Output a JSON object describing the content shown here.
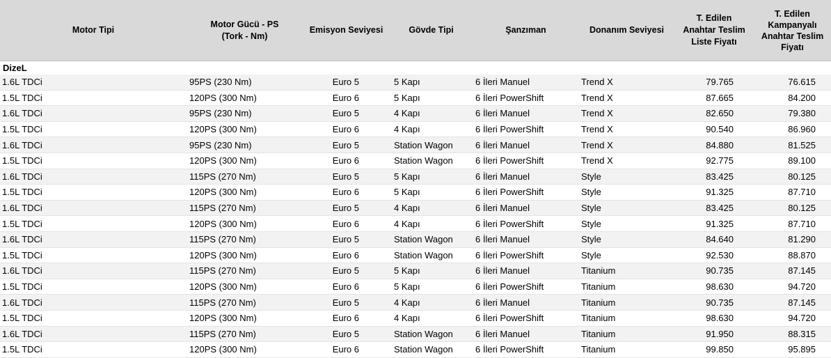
{
  "headers": {
    "motor_tipi": "Motor Tipi",
    "motor_gucu_1": "Motor Gücü - PS",
    "motor_gucu_2": "(Tork - Nm)",
    "emisyon": "Emisyon Seviyesi",
    "govde": "Gövde Tipi",
    "sanziman": "Şanzıman",
    "donanim": "Donanım Seviyesi",
    "liste_1": "T. Edilen",
    "liste_2": "Anahtar Teslim",
    "liste_3": "Liste Fiyatı",
    "kampanya_1": "T. Edilen",
    "kampanya_2": "Kampanyalı",
    "kampanya_3": "Anahtar Teslim",
    "kampanya_4": "Fiyatı"
  },
  "group_label": "DizeL",
  "rows": [
    {
      "motor": "1.6L TDCi",
      "power": "95PS (230 Nm)",
      "emission": "Euro 5",
      "body": "5 Kapı",
      "transmission": "6 İleri Manuel",
      "trim": "Trend X",
      "list_price": "79.765",
      "campaign_price": "76.615"
    },
    {
      "motor": "1.5L TDCi",
      "power": "120PS (300 Nm)",
      "emission": "Euro 6",
      "body": "5 Kapı",
      "transmission": "6 İleri PowerShift",
      "trim": "Trend X",
      "list_price": "87.665",
      "campaign_price": "84.200"
    },
    {
      "motor": "1.6L TDCi",
      "power": "95PS (230 Nm)",
      "emission": "Euro 5",
      "body": "4 Kapı",
      "transmission": "6 İleri Manuel",
      "trim": "Trend X",
      "list_price": "82.650",
      "campaign_price": "79.380"
    },
    {
      "motor": "1.5L TDCi",
      "power": "120PS (300 Nm)",
      "emission": "Euro 6",
      "body": "4 Kapı",
      "transmission": "6 İleri PowerShift",
      "trim": "Trend X",
      "list_price": "90.540",
      "campaign_price": "86.960"
    },
    {
      "motor": "1.6L TDCi",
      "power": "95PS (230 Nm)",
      "emission": "Euro 5",
      "body": "Station Wagon",
      "transmission": "6 İleri Manuel",
      "trim": "Trend X",
      "list_price": "84.880",
      "campaign_price": "81.525"
    },
    {
      "motor": "1.5L TDCi",
      "power": "120PS (300 Nm)",
      "emission": "Euro 6",
      "body": "Station Wagon",
      "transmission": "6 İleri PowerShift",
      "trim": "Trend X",
      "list_price": "92.775",
      "campaign_price": "89.100"
    },
    {
      "motor": "1.6L TDCi",
      "power": "115PS (270 Nm)",
      "emission": "Euro 5",
      "body": "5 Kapı",
      "transmission": "6 İleri Manuel",
      "trim": "Style",
      "list_price": "83.425",
      "campaign_price": "80.125"
    },
    {
      "motor": "1.5L TDCi",
      "power": "120PS (300 Nm)",
      "emission": "Euro 6",
      "body": "5 Kapı",
      "transmission": "6 İleri PowerShift",
      "trim": "Style",
      "list_price": "91.325",
      "campaign_price": "87.710"
    },
    {
      "motor": "1.6L TDCi",
      "power": "115PS (270 Nm)",
      "emission": "Euro 5",
      "body": "4 Kapı",
      "transmission": "6 İleri Manuel",
      "trim": "Style",
      "list_price": "83.425",
      "campaign_price": "80.125"
    },
    {
      "motor": "1.5L TDCi",
      "power": "120PS (300 Nm)",
      "emission": "Euro 6",
      "body": "4 Kapı",
      "transmission": "6 İleri PowerShift",
      "trim": "Style",
      "list_price": "91.325",
      "campaign_price": "87.710"
    },
    {
      "motor": "1.6L TDCi",
      "power": "115PS (270 Nm)",
      "emission": "Euro 5",
      "body": "Station Wagon",
      "transmission": "6 İleri Manuel",
      "trim": "Style",
      "list_price": "84.640",
      "campaign_price": "81.290"
    },
    {
      "motor": "1.5L TDCi",
      "power": "120PS (300 Nm)",
      "emission": "Euro 6",
      "body": "Station Wagon",
      "transmission": "6 İleri PowerShift",
      "trim": "Style",
      "list_price": "92.530",
      "campaign_price": "88.870"
    },
    {
      "motor": "1.6L TDCi",
      "power": "115PS (270 Nm)",
      "emission": "Euro 5",
      "body": "5 Kapı",
      "transmission": "6 İleri Manuel",
      "trim": "Titanium",
      "list_price": "90.735",
      "campaign_price": "87.145"
    },
    {
      "motor": "1.5L TDCi",
      "power": "120PS (300 Nm)",
      "emission": "Euro 6",
      "body": "5 Kapı",
      "transmission": "6 İleri PowerShift",
      "trim": "Titanium",
      "list_price": "98.630",
      "campaign_price": "94.720"
    },
    {
      "motor": "1.6L TDCi",
      "power": "115PS (270 Nm)",
      "emission": "Euro 5",
      "body": "4 Kapı",
      "transmission": "6 İleri Manuel",
      "trim": "Titanium",
      "list_price": "90.735",
      "campaign_price": "87.145"
    },
    {
      "motor": "1.5L TDCi",
      "power": "120PS (300 Nm)",
      "emission": "Euro 6",
      "body": "4 Kapı",
      "transmission": "6 İleri PowerShift",
      "trim": "Titanium",
      "list_price": "98.630",
      "campaign_price": "94.720"
    },
    {
      "motor": "1.6L TDCi",
      "power": "115PS (270 Nm)",
      "emission": "Euro 5",
      "body": "Station Wagon",
      "transmission": "6 İleri Manuel",
      "trim": "Titanium",
      "list_price": "91.950",
      "campaign_price": "88.315"
    },
    {
      "motor": "1.5L TDCi",
      "power": "120PS (300 Nm)",
      "emission": "Euro 6",
      "body": "Station Wagon",
      "transmission": "6 İleri PowerShift",
      "trim": "Titanium",
      "list_price": "99.850",
      "campaign_price": "95.895"
    }
  ]
}
